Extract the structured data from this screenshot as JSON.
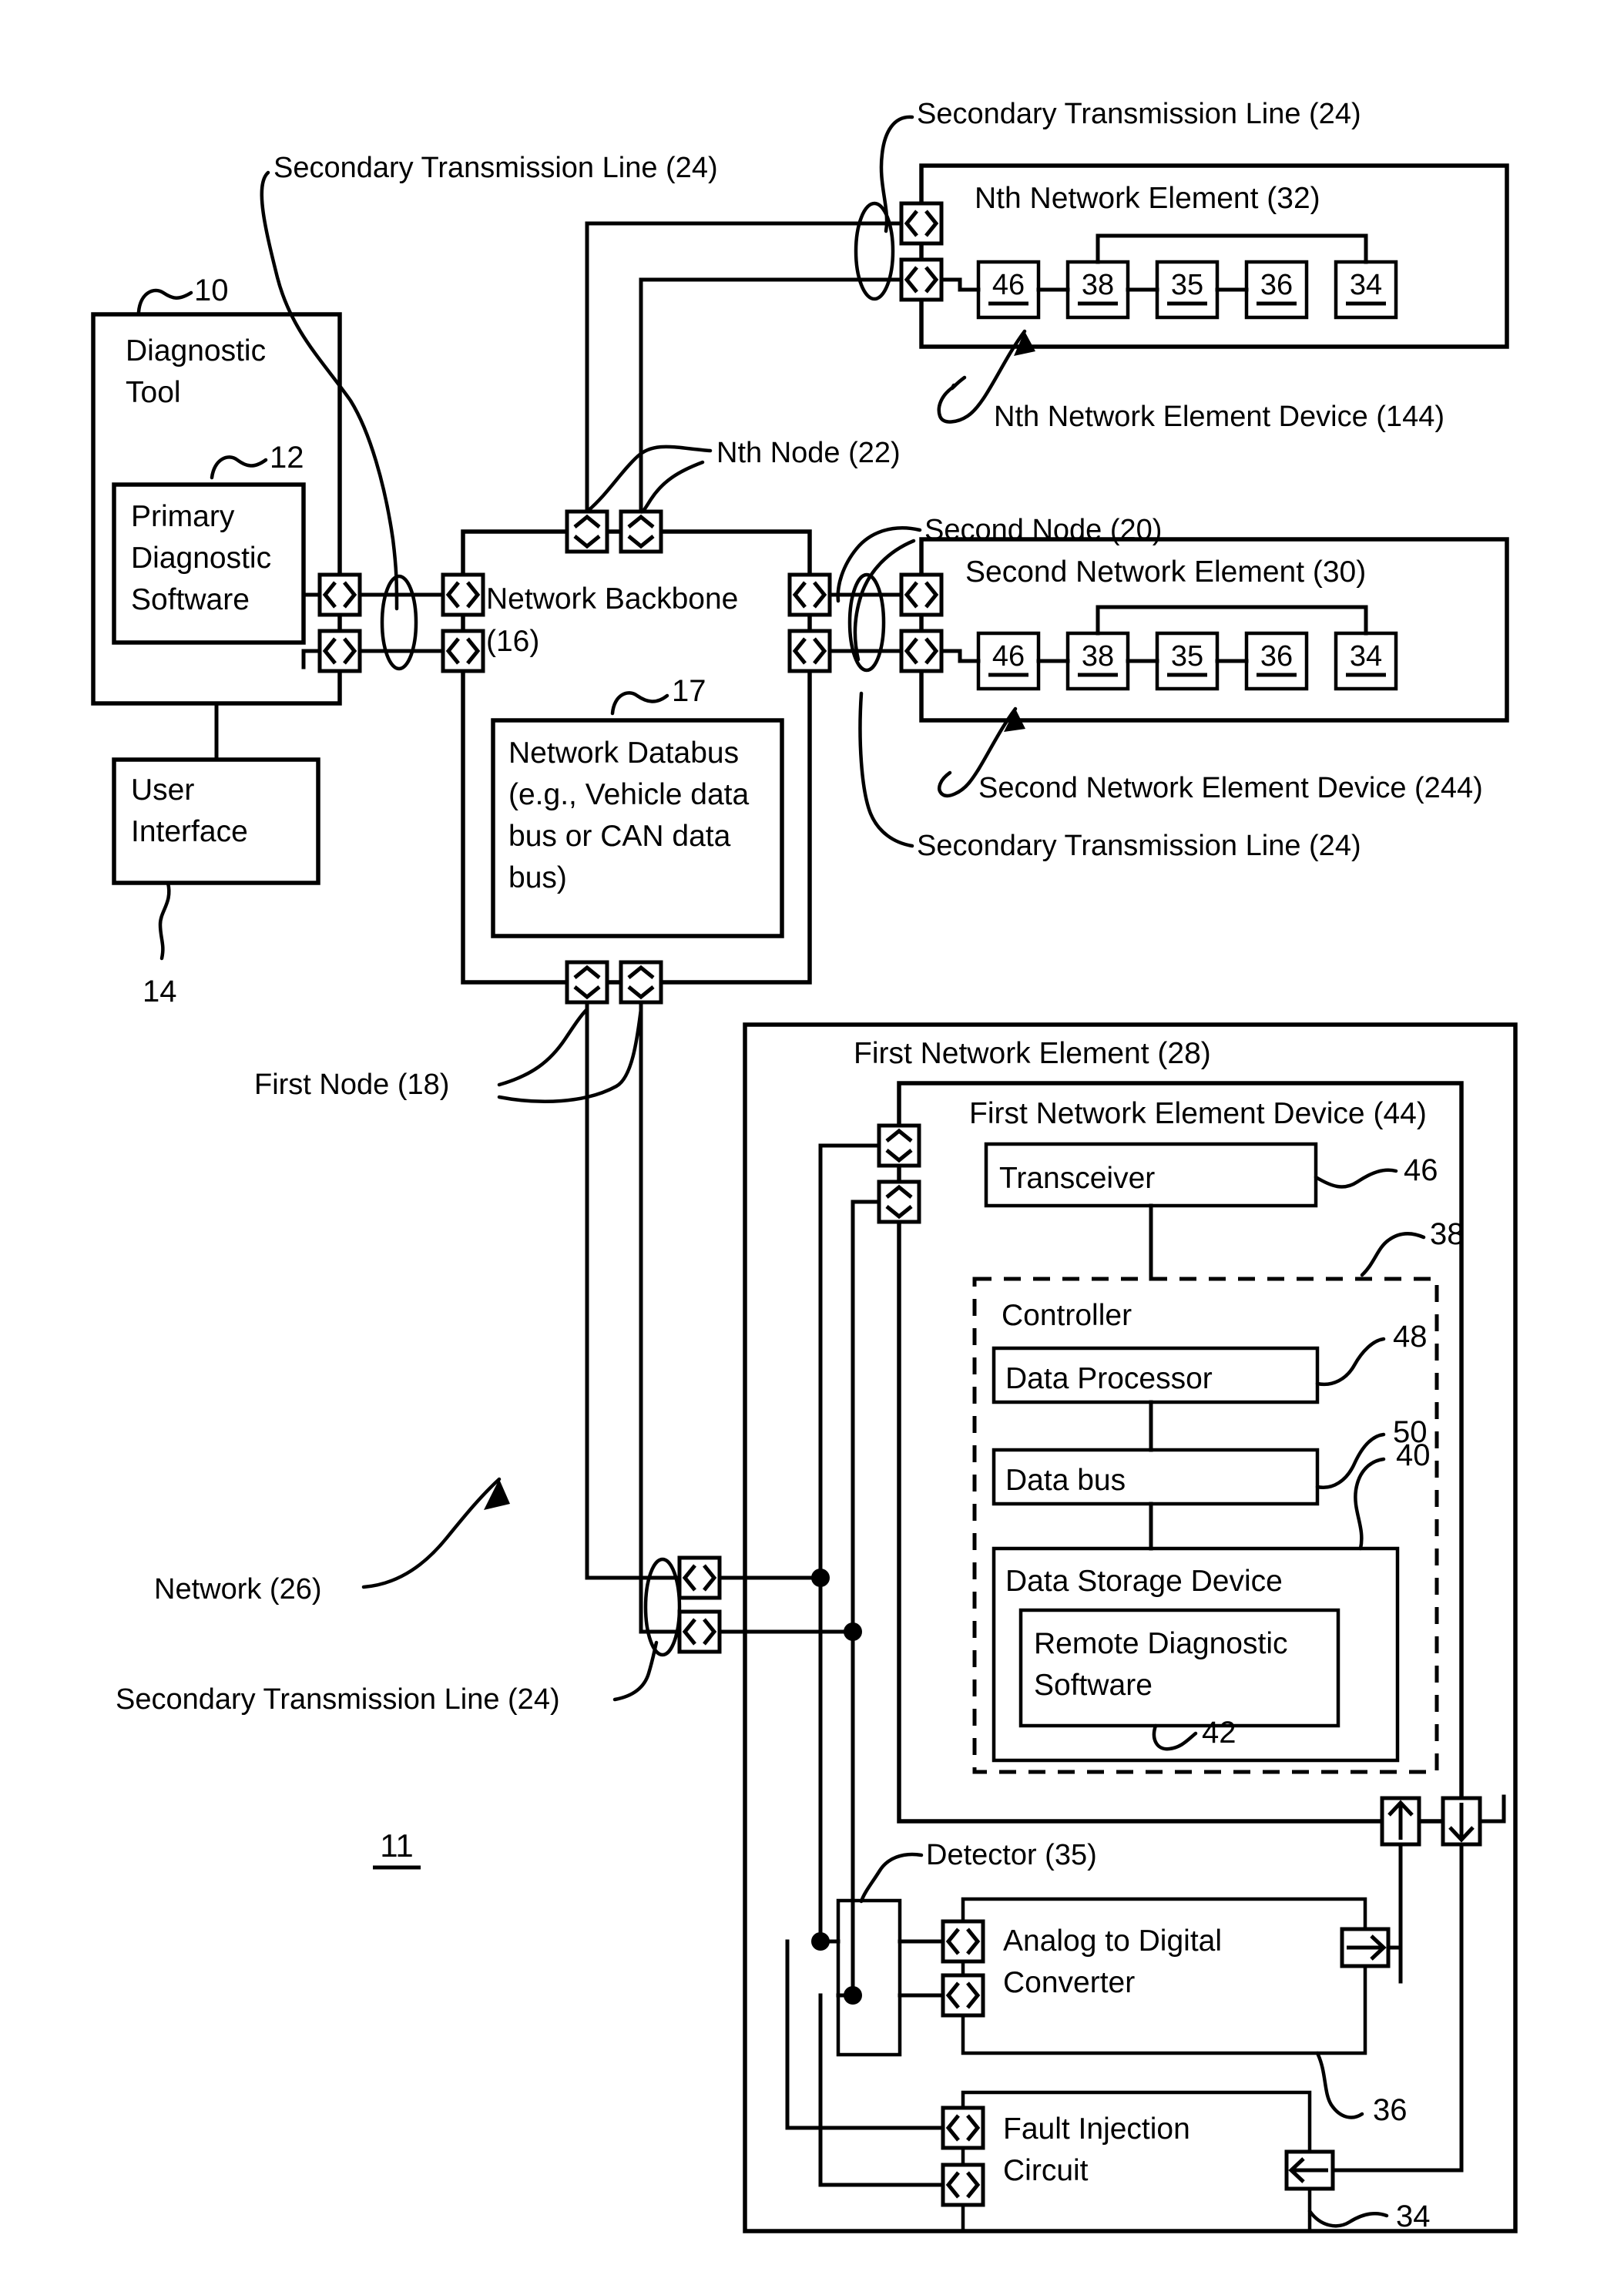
{
  "figure": {
    "number": "11",
    "type": "patent-block-diagram"
  },
  "labels": {
    "secondary_transmission_line_top_left": "Secondary Transmission Line (24)",
    "secondary_transmission_line_top_right": "Secondary Transmission Line (24)",
    "secondary_transmission_line_mid_right": "Secondary Transmission Line (24)",
    "secondary_transmission_line_bottom_left": "Secondary Transmission Line (24)",
    "nth_network_element": "Nth Network Element (32)",
    "nth_network_element_device": "Nth Network Element Device (144)",
    "second_network_element": "Second Network Element (30)",
    "second_network_element_device": "Second Network Element Device (244)",
    "first_network_element": "First Network Element (28)",
    "first_network_element_device": "First Network Element Device (44)",
    "nth_node": "Nth Node (22)",
    "second_node": "Second Node (20)",
    "first_node": "First Node (18)",
    "network": "Network (26)",
    "detector": "Detector (35)"
  },
  "boxes": {
    "diagnostic_tool": "Diagnostic Tool",
    "primary_diagnostic_software": "Primary Diagnostic Software",
    "user_interface": "User Interface",
    "network_backbone": "Network Backbone (16)",
    "network_databus": "Network Databus (e.g., Vehicle data bus or CAN data bus)",
    "transceiver": "Transceiver",
    "controller": "Controller",
    "data_processor": "Data Processor",
    "data_bus": "Data bus",
    "data_storage_device": "Data Storage Device",
    "remote_diagnostic_software": "Remote Diagnostic Software",
    "analog_to_digital_converter": "Analog to Digital Converter",
    "fault_injection_circuit": "Fault Injection Circuit"
  },
  "reference_numbers": {
    "diagnostic_tool": "10",
    "primary_diagnostic_software": "12",
    "user_interface": "14",
    "network_databus": "17",
    "transceiver": "46",
    "controller": "38",
    "data_processor": "48",
    "data_bus": "50",
    "data_storage_device": "40",
    "remote_diagnostic_software": "42",
    "analog_to_digital_converter": "36",
    "fault_injection_circuit": "34"
  },
  "element_chain": {
    "nth": [
      "46",
      "38",
      "35",
      "36",
      "34"
    ],
    "second": [
      "46",
      "38",
      "35",
      "36",
      "34"
    ]
  },
  "icons": {
    "bidirectional_port": "bidirectional-port-icon",
    "vertical_port": "vertical-port-icon",
    "arrow_up": "arrow-up-icon",
    "arrow_down": "arrow-down-icon",
    "arrow_right": "arrow-right-icon",
    "arrow_left": "arrow-left-icon",
    "transmission_loop": "transmission-loop-icon",
    "junction_dot": "junction-dot-icon"
  },
  "colors": {
    "line": "#000000",
    "background": "#ffffff",
    "text": "#000000"
  }
}
